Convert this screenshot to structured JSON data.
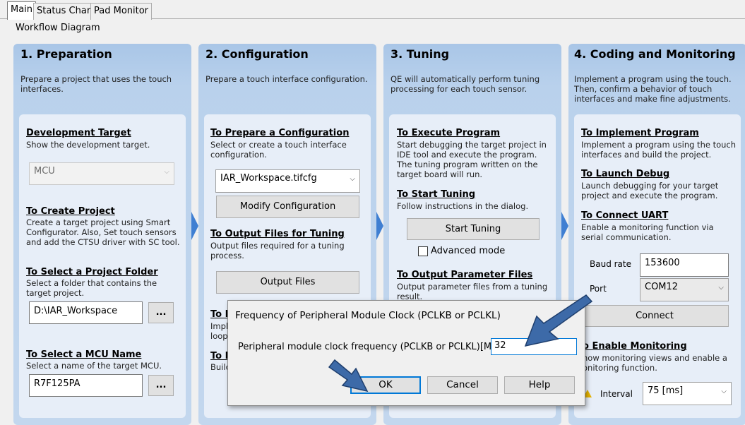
{
  "tabs": [
    {
      "label": "Main"
    },
    {
      "label": "Status Chart"
    },
    {
      "label": "Pad Monitor"
    }
  ],
  "workflow_label": "Workflow Diagram",
  "columns": {
    "preparation": {
      "title": "1. Preparation",
      "description": "Prepare a project that uses the touch interfaces.",
      "dev_target_heading": "Development Target",
      "dev_target_sub": "Show the development target.",
      "mcu_select": "MCU",
      "create_project_heading": "To Create Project",
      "create_project_sub": "Create a target project using Smart Configurator. Also, Set touch sensors and add the CTSU driver with SC tool.",
      "select_folder_heading": "To Select a Project Folder",
      "select_folder_sub": "Select a folder that contains the target project.",
      "folder_value": "D:\\IAR_Workspace",
      "browse_label": "...",
      "select_mcu_heading": "To Select a MCU Name",
      "select_mcu_sub": "Select a name of the target MCU.",
      "mcu_value": "R7F125PA",
      "browse_label2": "..."
    },
    "configuration": {
      "title": "2. Configuration",
      "description": "Prepare a touch interface configuration.",
      "prepare_heading": "To Prepare a Configuration",
      "prepare_sub": "Select or create a touch interface configuration.",
      "config_file": "IAR_Workspace.tifcfg",
      "modify_button": "Modify Configuration",
      "output_heading": "To Output Files for Tuning",
      "output_sub": "Output files required for a tuning process.",
      "output_button": "Output Files",
      "hidden_heading_1": "To I",
      "hidden_sub_1a": "Impl",
      "hidden_sub_1b": "loop",
      "hidden_heading_2": "To B",
      "hidden_sub_2": "Build"
    },
    "tuning": {
      "title": "3. Tuning",
      "description": "QE will automatically perform tuning processing for each touch sensor.",
      "execute_heading": "To Execute Program",
      "execute_sub": "Start debugging the target project in IDE tool and execute the program. The tuning program written on the target board will run.",
      "start_heading": "To Start Tuning",
      "start_sub": "Follow instructions in the dialog.",
      "start_button": "Start Tuning",
      "advanced_mode": "Advanced mode",
      "output_param_heading": "To Output Parameter Files",
      "output_param_sub": "Output parameter files from a tuning result."
    },
    "coding": {
      "title": "4. Coding and Monitoring",
      "description": "Implement a program using the touch. Then, confirm a behavior of touch interfaces and make fine adjustments.",
      "implement_heading": "To Implement Program",
      "implement_sub": "Implement a program using the touch interfaces and build the project.",
      "launch_heading": "To Launch Debug",
      "launch_sub": "Launch debugging for your target project and execute the program.",
      "uart_heading": "To Connect UART",
      "uart_sub": "Enable a monitoring function via serial communication.",
      "baud_label": "Baud rate",
      "baud_value": "153600",
      "port_label": "Port",
      "port_value": "COM12",
      "connect_button": "Connect",
      "monitoring_heading": "o Enable Monitoring",
      "monitoring_sub": "how monitoring views and enable a onitoring function.",
      "interval_label": "Interval",
      "interval_value": "75 [ms]"
    }
  },
  "dialog": {
    "title": "Frequency of Peripheral Module Clock (PCLKB or PCLKL)",
    "label": "Peripheral module clock frequency (PCLKB or PCLKL)[MHz]",
    "value": "32",
    "ok": "OK",
    "cancel": "Cancel",
    "help": "Help"
  },
  "colors": {
    "annotation_arrow": "#3d6aa8",
    "flow_chevron": "#3f7fd2",
    "column_bg": "#b9d1ec",
    "focus": "#0078d7"
  }
}
